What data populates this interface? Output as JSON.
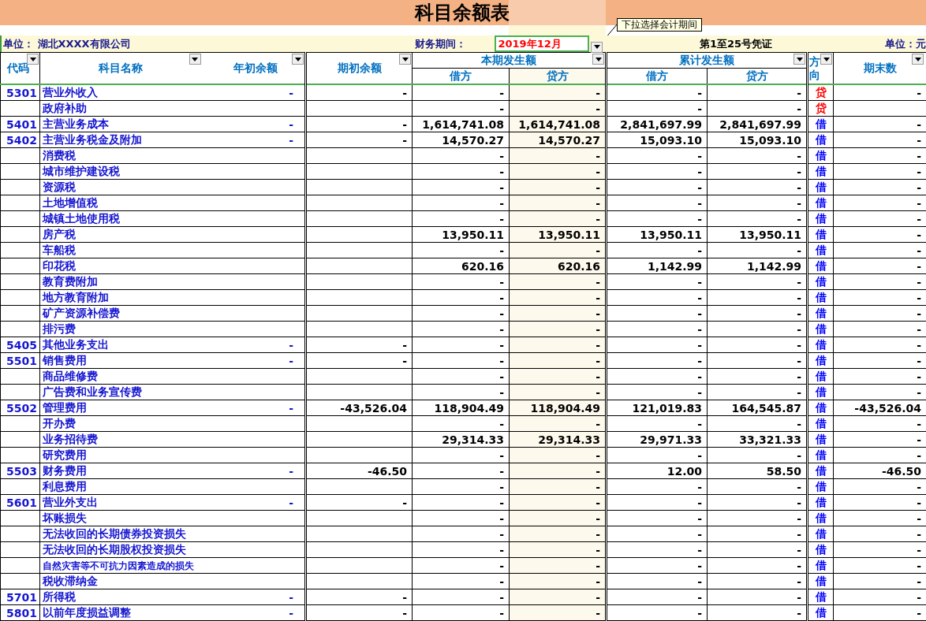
{
  "title": "科目余额表",
  "note": "下拉选择会计期间",
  "info": {
    "unit": "单位： 湖北XXXX有限公司",
    "period_label": "财务期间：",
    "period": "2019年12月",
    "voucher_range": "第1至25号凭证",
    "currency_unit": "单位：元"
  },
  "header": {
    "code": "代码",
    "name": "科目名称",
    "year_open": "年初余额",
    "period_open": "期初余额",
    "current": {
      "title": "本期发生额",
      "debit": "借方",
      "credit": "贷方"
    },
    "cumulative": {
      "title": "累计发生额",
      "debit": "借方",
      "credit": "贷方"
    },
    "direction": "方向",
    "closing": "期末数"
  },
  "rows": [
    {
      "code": "5301",
      "name": "营业外收入",
      "year_open": "-",
      "period_open": "-",
      "values": [
        "-",
        "-",
        "-",
        "-"
      ],
      "direction": "贷",
      "color": "#ff0000",
      "closing": "-"
    },
    {
      "name": "政府补助",
      "values": [
        "-",
        "-",
        "-",
        "-"
      ],
      "direction": "贷",
      "color": "#ff0000"
    },
    {
      "code": "5401",
      "name": "主营业务成本",
      "year_open": "-",
      "period_open": "-",
      "values": [
        "1,614,741.08",
        "1,614,741.08",
        "2,841,697.99",
        "2,841,697.99"
      ],
      "direction": "借",
      "color": "#0000ff",
      "closing": "-"
    },
    {
      "code": "5402",
      "name": "主营业务税金及附加",
      "year_open": "-",
      "period_open": "-",
      "values": [
        "14,570.27",
        "14,570.27",
        "15,093.10",
        "15,093.10"
      ],
      "direction": "借",
      "color": "#0000ff",
      "closing": "-"
    },
    {
      "name": "消费税",
      "values": [
        "-",
        "-",
        "-",
        "-"
      ],
      "direction": "借",
      "color": "#0000ff",
      "closing": "-"
    },
    {
      "name": "城市维护建设税",
      "values": [
        "-",
        "-",
        "-",
        "-"
      ],
      "direction": "借",
      "color": "#0000ff",
      "closing": "-"
    },
    {
      "name": "资源税",
      "values": [
        "-",
        "-",
        "-",
        "-"
      ],
      "direction": "借",
      "color": "#0000ff",
      "closing": "-"
    },
    {
      "name": "土地增值税",
      "values": [
        "-",
        "-",
        "-",
        "-"
      ],
      "direction": "借",
      "color": "#0000ff",
      "closing": "-"
    },
    {
      "name": "城镇土地使用税",
      "values": [
        "-",
        "-",
        "-",
        "-"
      ],
      "direction": "借",
      "color": "#0000ff",
      "closing": "-"
    },
    {
      "name": "房产税",
      "values": [
        "13,950.11",
        "13,950.11",
        "13,950.11",
        "13,950.11"
      ],
      "direction": "借",
      "color": "#0000ff",
      "closing": "-"
    },
    {
      "name": "车船税",
      "values": [
        "-",
        "-",
        "-",
        "-"
      ],
      "direction": "借",
      "color": "#0000ff",
      "closing": "-"
    },
    {
      "name": "印花税",
      "values": [
        "620.16",
        "620.16",
        "1,142.99",
        "1,142.99"
      ],
      "direction": "借",
      "color": "#0000ff",
      "closing": "-"
    },
    {
      "name": "教育费附加",
      "values": [
        "-",
        "-",
        "-",
        "-"
      ],
      "direction": "借",
      "color": "#0000ff",
      "closing": "-"
    },
    {
      "name": "地方教育附加",
      "values": [
        "-",
        "-",
        "-",
        "-"
      ],
      "direction": "借",
      "color": "#0000ff",
      "closing": "-"
    },
    {
      "name": "矿产资源补偿费",
      "values": [
        "-",
        "-",
        "-",
        "-"
      ],
      "direction": "借",
      "color": "#0000ff",
      "closing": "-"
    },
    {
      "name": "排污费",
      "values": [
        "-",
        "-",
        "-",
        "-"
      ],
      "direction": "借",
      "color": "#0000ff",
      "closing": "-"
    },
    {
      "code": "5405",
      "name": "其他业务支出",
      "year_open": "-",
      "period_open": "-",
      "values": [
        "-",
        "-",
        "-",
        "-"
      ],
      "direction": "借",
      "color": "#0000ff",
      "closing": "-"
    },
    {
      "code": "5501",
      "name": "销售费用",
      "year_open": "-",
      "period_open": "-",
      "values": [
        "-",
        "-",
        "-",
        "-"
      ],
      "direction": "借",
      "color": "#0000ff",
      "closing": "-"
    },
    {
      "name": "商品维修费",
      "values": [
        "-",
        "-",
        "-",
        "-"
      ],
      "direction": "借",
      "color": "#0000ff",
      "closing": "-"
    },
    {
      "name": "广告费和业务宣传费",
      "values": [
        "-",
        "-",
        "-",
        "-"
      ],
      "direction": "借",
      "color": "#0000ff",
      "closing": "-"
    },
    {
      "code": "5502",
      "name": "管理费用",
      "year_open": "-",
      "period_open": "-43,526.04",
      "values": [
        "118,904.49",
        "118,904.49",
        "121,019.83",
        "164,545.87"
      ],
      "direction": "借",
      "color": "#0000ff",
      "closing": "-43,526.04"
    },
    {
      "name": "开办费",
      "values": [
        "-",
        "-",
        "-",
        "-"
      ],
      "direction": "借",
      "color": "#0000ff",
      "closing": "-"
    },
    {
      "name": "业务招待费",
      "values": [
        "29,314.33",
        "29,314.33",
        "29,971.33",
        "33,321.33"
      ],
      "direction": "借",
      "color": "#0000ff",
      "closing": "-"
    },
    {
      "name": "研究费用",
      "values": [
        "-",
        "-",
        "-",
        "-"
      ],
      "direction": "借",
      "color": "#0000ff",
      "closing": "-"
    },
    {
      "code": "5503",
      "name": "财务费用",
      "year_open": "-",
      "period_open": "-46.50",
      "values": [
        "-",
        "-",
        "12.00",
        "58.50"
      ],
      "direction": "借",
      "color": "#0000ff",
      "closing": "-46.50"
    },
    {
      "name": "利息费用",
      "values": [
        "-",
        "-",
        "-",
        "-"
      ],
      "direction": "借",
      "color": "#0000ff",
      "closing": "-"
    },
    {
      "code": "5601",
      "name": "营业外支出",
      "year_open": "-",
      "period_open": "-",
      "values": [
        "-",
        "-",
        "-",
        "-"
      ],
      "direction": "借",
      "color": "#0000ff",
      "closing": "-"
    },
    {
      "name": "坏账损失",
      "values": [
        "-",
        "-",
        "-",
        "-"
      ],
      "direction": "借",
      "color": "#0000ff",
      "closing": "-"
    },
    {
      "name": "无法收回的长期债券投资损失",
      "values": [
        "-",
        "-",
        "-",
        "-"
      ],
      "direction": "借",
      "color": "#0000ff",
      "closing": "-"
    },
    {
      "name": "无法收回的长期股权投资损失",
      "values": [
        "-",
        "-",
        "-",
        "-"
      ],
      "direction": "借",
      "color": "#0000ff",
      "closing": "-"
    },
    {
      "name": "自然灾害等不可抗力因素造成的损失",
      "values": [
        "-",
        "-",
        "-",
        "-"
      ],
      "direction": "借",
      "color": "#0000ff",
      "closing": "-"
    },
    {
      "name": "税收滞纳金",
      "values": [
        "-",
        "-",
        "-",
        "-"
      ],
      "direction": "借",
      "color": "#0000ff",
      "closing": "-"
    },
    {
      "code": "5701",
      "name": "所得税",
      "year_open": "-",
      "period_open": "-",
      "values": [
        "-",
        "-",
        "-",
        "-"
      ],
      "direction": "借",
      "color": "#0000ff",
      "closing": "-"
    },
    {
      "code": "5801",
      "name": "以前年度损益调整",
      "year_open": "-",
      "period_open": "-",
      "values": [
        "-",
        "-",
        "-",
        "-"
      ],
      "direction": "借",
      "color": "#0000ff",
      "closing": "-"
    }
  ]
}
